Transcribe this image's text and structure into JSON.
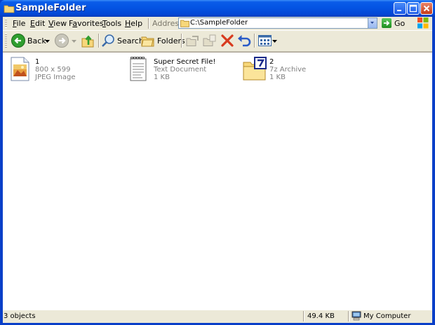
{
  "window": {
    "title": "SampleFolder"
  },
  "menu": {
    "items": [
      {
        "label": "File",
        "accel": "F",
        "rest": "ile"
      },
      {
        "label": "Edit",
        "accel": "E",
        "rest": "dit"
      },
      {
        "label": "View",
        "accel": "V",
        "rest": "iew"
      },
      {
        "label": "Favorites",
        "accel": "F",
        "rest": "avorites",
        "prefix": "F"
      },
      {
        "label": "Tools",
        "accel": "T",
        "rest": "ools"
      },
      {
        "label": "Help",
        "accel": "H",
        "rest": "elp"
      }
    ]
  },
  "address": {
    "label": "Address",
    "path": "C:\\SampleFolder",
    "go_label": "Go"
  },
  "toolbar": {
    "back_label": "Back",
    "search_label": "Search",
    "folders_label": "Folders"
  },
  "files": [
    {
      "name": "1",
      "detail": "800 x 599",
      "type": "JPEG Image",
      "icon": "jpeg-image-icon"
    },
    {
      "name": "Super Secret File!",
      "detail": "Text Document",
      "type": "1 KB",
      "icon": "text-document-icon"
    },
    {
      "name": "2",
      "detail": "7z Archive",
      "type": "1 KB",
      "icon": "7z-archive-icon"
    }
  ],
  "status": {
    "objects": "3 objects",
    "size": "49.4 KB",
    "location": "My Computer"
  },
  "colors": {
    "titlebar": "#0454e3",
    "frame": "#ece9d8",
    "go_green": "#1e8e1e",
    "delete_red": "#d83a1e"
  }
}
